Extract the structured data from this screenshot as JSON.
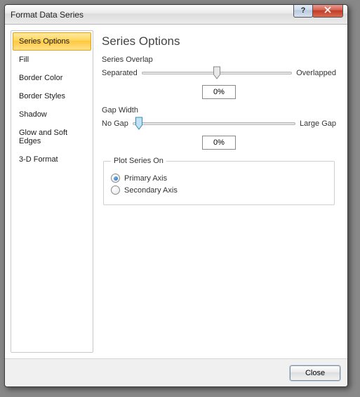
{
  "window": {
    "title": "Format Data Series"
  },
  "nav": {
    "items": [
      {
        "label": "Series Options"
      },
      {
        "label": "Fill"
      },
      {
        "label": "Border Color"
      },
      {
        "label": "Border Styles"
      },
      {
        "label": "Shadow"
      },
      {
        "label": "Glow and Soft Edges"
      },
      {
        "label": "3-D Format"
      }
    ],
    "selected_index": 0
  },
  "panel": {
    "heading": "Series Options",
    "overlap": {
      "label": "Series Overlap",
      "left_label": "Separated",
      "right_label": "Overlapped",
      "value": "0%",
      "pos_pct": 50
    },
    "gap": {
      "label": "Gap Width",
      "left_label": "No Gap",
      "right_label": "Large Gap",
      "value": "0%",
      "pos_pct": 4
    },
    "plot": {
      "legend": "Plot Series On",
      "options": [
        {
          "label": "Primary Axis",
          "checked": true
        },
        {
          "label": "Secondary Axis",
          "checked": false
        }
      ]
    }
  },
  "footer": {
    "close": "Close"
  }
}
